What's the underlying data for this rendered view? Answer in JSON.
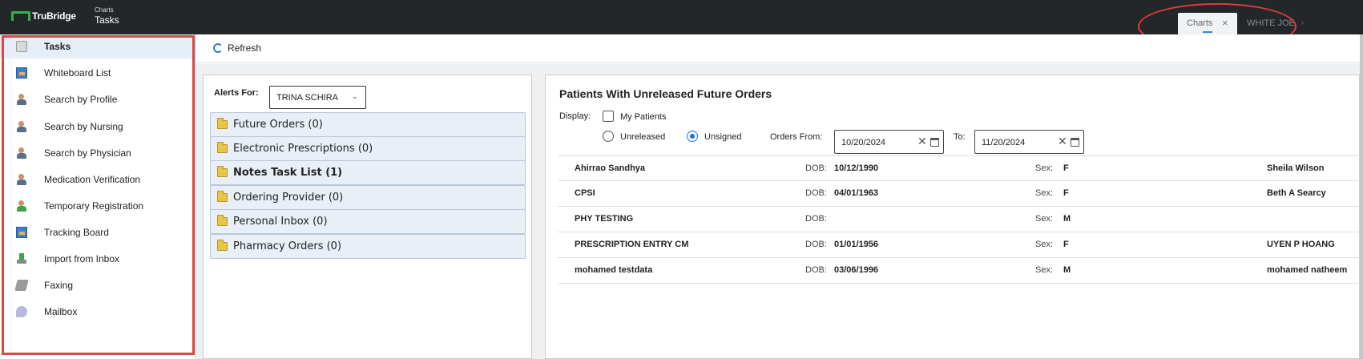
{
  "app": {
    "logo_text": "TruBridge",
    "breadcrumb_module": "Charts",
    "breadcrumb_page": "Tasks"
  },
  "tabs": [
    {
      "label": "Charts",
      "close": "×"
    },
    {
      "label": "WHITE JOE",
      "arrow": "›"
    }
  ],
  "sidebar": {
    "items": [
      {
        "label": "Tasks",
        "icon": "clipboard-icon",
        "active": true
      },
      {
        "label": "Whiteboard List",
        "icon": "whiteboard-icon"
      },
      {
        "label": "Search by Profile",
        "icon": "person-search-icon"
      },
      {
        "label": "Search by Nursing",
        "icon": "nurse-icon"
      },
      {
        "label": "Search by Physician",
        "icon": "physician-icon"
      },
      {
        "label": "Medication Verification",
        "icon": "medication-icon"
      },
      {
        "label": "Temporary Registration",
        "icon": "registration-icon"
      },
      {
        "label": "Tracking Board",
        "icon": "tracking-board-icon"
      },
      {
        "label": "Import from Inbox",
        "icon": "import-icon"
      },
      {
        "label": "Faxing",
        "icon": "fax-icon"
      },
      {
        "label": "Mailbox",
        "icon": "mailbox-icon"
      }
    ]
  },
  "toolbar": {
    "refresh_label": "Refresh"
  },
  "alerts": {
    "label": "Alerts For:",
    "selected_user": "TRINA SCHIRA",
    "chevron": "⌄",
    "items": [
      {
        "label": "Future Orders (0)",
        "bold": false
      },
      {
        "label": "Electronic Prescriptions (0)",
        "bold": false
      },
      {
        "label": "Notes Task List (1)",
        "bold": true
      },
      {
        "label": "Ordering Provider (0)",
        "bold": false
      },
      {
        "label": "Personal Inbox (0)",
        "bold": false
      },
      {
        "label": "Pharmacy Orders (0)",
        "bold": false
      }
    ]
  },
  "orders": {
    "title": "Patients With Unreleased Future Orders",
    "display_label": "Display:",
    "my_patients_label": "My Patients",
    "my_patients_checked": false,
    "radio_unreleased": "Unreleased",
    "radio_unsigned": "Unsigned",
    "selected_radio": "Unsigned",
    "orders_from_label": "Orders From:",
    "orders_from_value": "10/20/2024",
    "to_label": "To:",
    "to_value": "11/20/2024",
    "clear_glyph": "✕",
    "dob_label": "DOB:",
    "sex_label": "Sex:",
    "patients": [
      {
        "name": "Ahirrao Sandhya",
        "dob": "10/12/1990",
        "sex": "F",
        "provider": "Sheila Wilson"
      },
      {
        "name": "CPSI",
        "dob": "04/01/1963",
        "sex": "F",
        "provider": "Beth A Searcy"
      },
      {
        "name": "PHY TESTING",
        "dob": "",
        "sex": "M",
        "provider": ""
      },
      {
        "name": "PRESCRIPTION ENTRY CM",
        "dob": "01/01/1956",
        "sex": "F",
        "provider": "UYEN P HOANG"
      },
      {
        "name": "mohamed testdata",
        "dob": "03/06/1996",
        "sex": "M",
        "provider": "mohamed natheem"
      }
    ]
  },
  "colors": {
    "topbar": "#24272a",
    "accent": "#1a73e8",
    "highlight_red": "#e04545",
    "logo_green": "#33b24a"
  }
}
